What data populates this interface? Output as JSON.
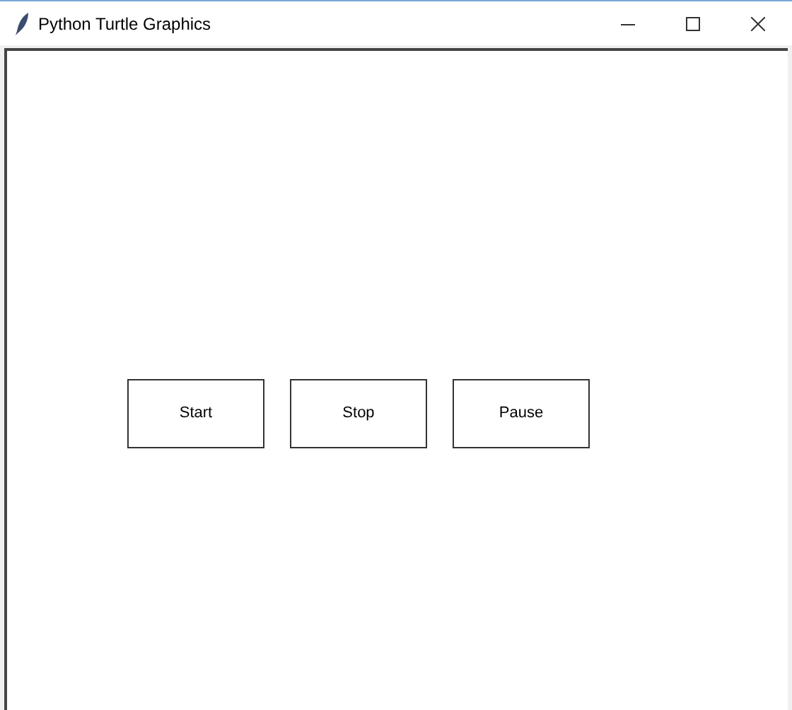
{
  "window": {
    "title": "Python Turtle Graphics"
  },
  "canvas": {
    "buttons": [
      {
        "label": "Start"
      },
      {
        "label": "Stop"
      },
      {
        "label": "Pause"
      }
    ]
  }
}
